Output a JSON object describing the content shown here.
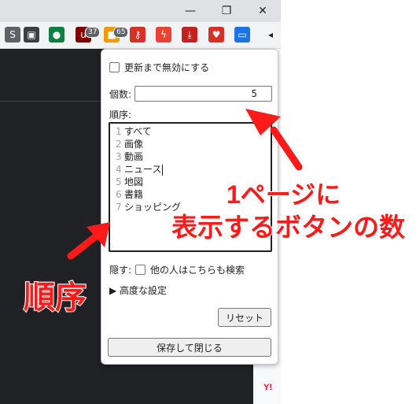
{
  "window": {
    "minimize": "—",
    "restore": "❐",
    "close": "✕"
  },
  "extensions": [
    {
      "name": "ext-s",
      "glyph": "S",
      "color": "#5f6368"
    },
    {
      "name": "ext-picture-in-picture",
      "glyph": "▣",
      "color": "#3c4043"
    },
    {
      "name": "ext-spy",
      "glyph": "●",
      "color": "#0b8043"
    },
    {
      "name": "ext-ublock",
      "glyph": "u",
      "color": "#800000",
      "badge": "37"
    },
    {
      "name": "ext-orange",
      "glyph": "■",
      "color": "#f29900",
      "badge": "65"
    },
    {
      "name": "ext-key",
      "glyph": "⚷",
      "color": "#d93025"
    },
    {
      "name": "ext-bolt",
      "glyph": "ϟ",
      "color": "#ea4335"
    },
    {
      "name": "ext-download",
      "glyph": "⤓",
      "color": "#c5221f"
    },
    {
      "name": "ext-heart",
      "glyph": "♥",
      "color": "#d93025"
    },
    {
      "name": "ext-active",
      "glyph": "▭",
      "color": "#1a73e8"
    },
    {
      "name": "ext-more",
      "glyph": "◂",
      "color": "#202124"
    }
  ],
  "popup": {
    "disable_label": "更新まで無効にする",
    "count_label": "個数:",
    "count_value": "5",
    "order_label": "順序:",
    "order_items": [
      {
        "n": "1",
        "text": "すべて"
      },
      {
        "n": "2",
        "text": "画像"
      },
      {
        "n": "3",
        "text": "動画"
      },
      {
        "n": "4",
        "text": "ニュース"
      },
      {
        "n": "5",
        "text": "地図"
      },
      {
        "n": "6",
        "text": "書籍"
      },
      {
        "n": "7",
        "text": "ショッピング"
      }
    ],
    "hide_label": "隠す:",
    "hide_option": "他の人はこちらも検索",
    "advanced_label": "▶ 高度な設定",
    "reset_button": "リセット",
    "save_button": "保存して閉じる"
  },
  "annotations": {
    "top_line1": "1ページに",
    "top_line2": "表示するボタンの数",
    "order": "順序"
  },
  "page": {
    "yahoo_icon": "Y!"
  },
  "colors": {
    "annotation": "#ff1a1a",
    "dark_page": "#202124"
  }
}
